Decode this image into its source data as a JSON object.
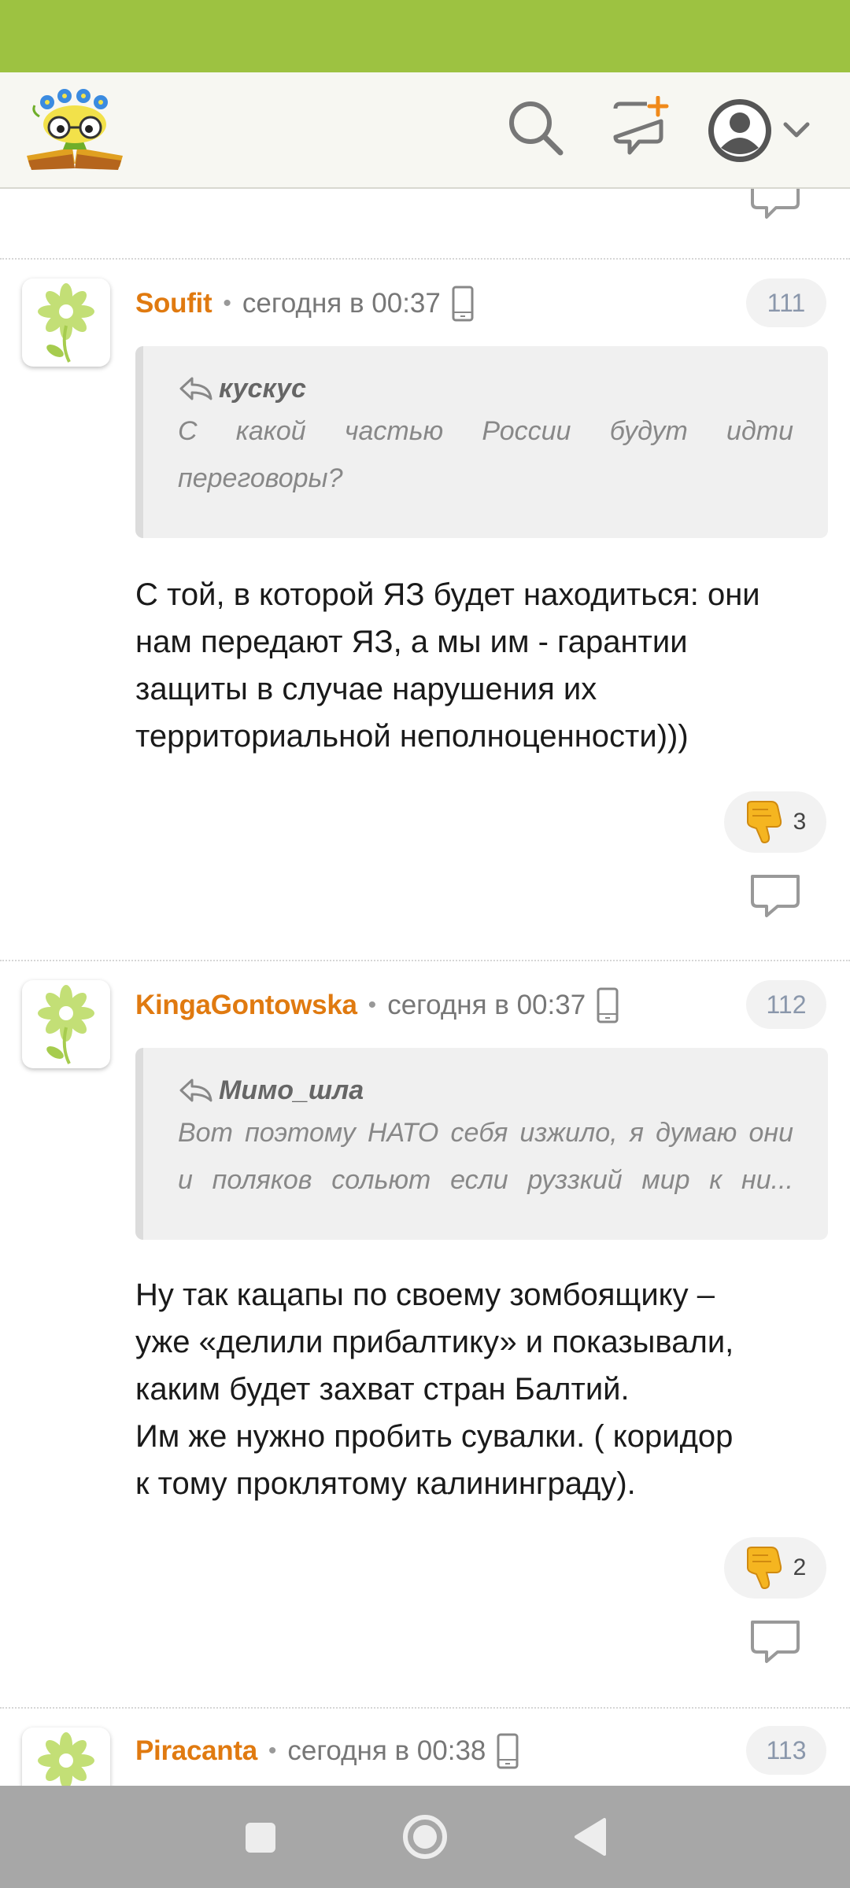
{
  "app": {
    "icons": [
      "logo",
      "search-icon",
      "new-post-icon",
      "avatar-icon",
      "chevron-down-icon"
    ],
    "colors": {
      "status_bar": "#9dc241",
      "header_bg": "#f7f7f2",
      "author": "#e07a10",
      "nav_bar": "#a7a7a7"
    }
  },
  "comments": [
    {
      "author": "Soufit",
      "time": "сегодня в 00:37",
      "number": "111",
      "quote": {
        "author": "кускус",
        "lines": [
          "С какой частью России будут идти",
          "переговоры?"
        ]
      },
      "text_lines": [
        "С той, в которой ЯЗ будет находиться: они",
        "нам передают ЯЗ, а мы им - гарантии",
        "защиты в случае нарушения их",
        "территориальной неполноценности)))"
      ],
      "reaction": {
        "icon": "thumbs-down",
        "count": "3"
      }
    },
    {
      "author": "KingaGontowska",
      "time": "сегодня в 00:37",
      "number": "112",
      "quote": {
        "author": "Мимо_шла",
        "lines": [
          "Вот поэтому НАТО себя изжило, я думаю они",
          "и поляков сольют если руззкий мир к ни..."
        ]
      },
      "text_lines": [
        "Ну так кацапы по своему зомбоящику –",
        "уже «делили прибалтику» и показывали,",
        "каким будет захват стран Балтий.",
        "Им же нужно пробить сувалки. ( коридор",
        "к тому проклятому калининграду)."
      ],
      "reaction": {
        "icon": "thumbs-down",
        "count": "2"
      }
    },
    {
      "author": "Piracanta",
      "time": "сегодня в 00:38",
      "number": "113"
    }
  ],
  "nav": {
    "icons": [
      "recents-square-icon",
      "home-circle-icon",
      "back-triangle-icon"
    ]
  }
}
